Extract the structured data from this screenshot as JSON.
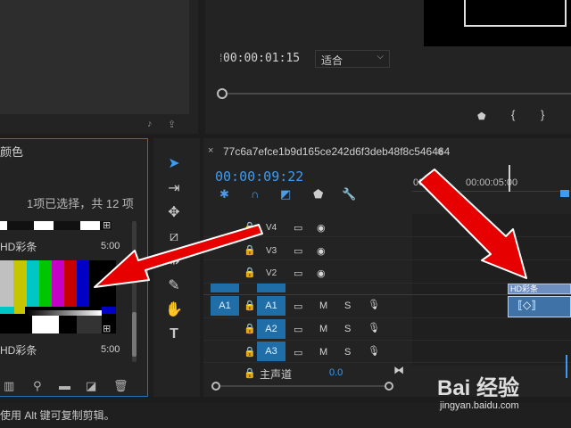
{
  "program_monitor": {
    "timecode": "00:00:01:15",
    "fit_value": "适合"
  },
  "project_panel": {
    "title": "颜色",
    "selection_count": "1项已选择，共 12 项",
    "clips": [
      {
        "label": "HD彩条",
        "duration": "5:00"
      },
      {
        "label": "HD彩条",
        "duration": "5:00"
      }
    ],
    "bars_colors": [
      "#c0c0c0",
      "#c6c600",
      "#00c6c6",
      "#00c600",
      "#c600c6",
      "#c60000",
      "#0000c6"
    ]
  },
  "timeline": {
    "sequence_name": "77c6a7efce1b9d165ce242d6f3deb48f8c546464",
    "timecode": "00:00:09:22",
    "ruler_labels": [
      "00:00",
      "00:00:05:00"
    ],
    "video_tracks": [
      "V4",
      "V3",
      "V2"
    ],
    "audio_tracks": [
      {
        "source": "A1",
        "target": "A1"
      },
      {
        "target": "A2"
      },
      {
        "target": "A3"
      }
    ],
    "audio_buttons": {
      "mute": "M",
      "solo": "S"
    },
    "master_label": "主声道",
    "master_value": "0.0",
    "clip_label": "HD彩条"
  },
  "status_bar": {
    "text": "使用 Alt 键可复制剪辑。"
  },
  "watermark": {
    "brand": "Bai 经验",
    "url": "jingyan.baidu.com"
  },
  "colors": {
    "accent": "#3c9cf2",
    "track_target": "#1f6ea8",
    "arrow": "#e60000"
  }
}
